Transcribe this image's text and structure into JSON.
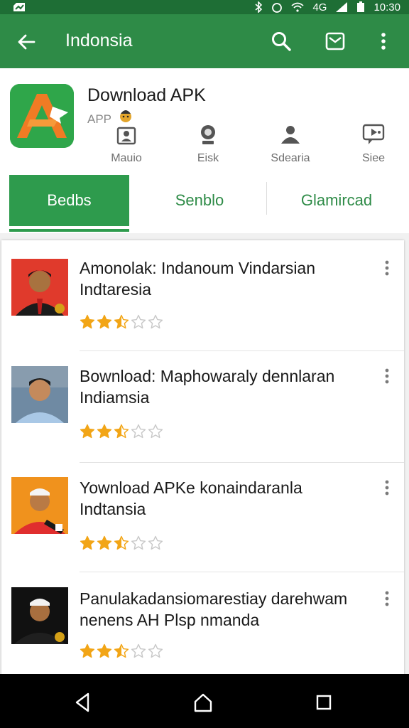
{
  "status_bar": {
    "network": "4G",
    "time": "10:30"
  },
  "app_bar": {
    "title": "Indonsia",
    "back_icon": "arrow-back-icon",
    "actions": [
      "search-icon",
      "mail-icon",
      "more-vert-icon"
    ]
  },
  "header": {
    "app_name": "Download APK",
    "app_sub": "APP",
    "mini_actions": [
      {
        "label": "Mauio",
        "icon": "user-badge-icon"
      },
      {
        "label": "Eisk",
        "icon": "webcam-icon"
      },
      {
        "label": "Sdearia",
        "icon": "person-info-icon"
      },
      {
        "label": "Siee",
        "icon": "chat-video-icon"
      }
    ],
    "tabs": [
      {
        "label": "Bedbs",
        "active": true
      },
      {
        "label": "Senblo",
        "active": false
      },
      {
        "label": "Glamircad",
        "active": false
      }
    ]
  },
  "list": {
    "items": [
      {
        "line1": "Amonolak: Indanoum Vindarsian",
        "line2": "Indtaresia",
        "rating": 2.5,
        "thumb_bg": "#e03a2c"
      },
      {
        "line1": "Bownload: Maphowaraly dennlaran",
        "line2": "Indiamsia",
        "rating": 2.5,
        "thumb_bg": "#5f7f9b"
      },
      {
        "line1": "Yownload APKe konaindaranla",
        "line2": "Indtansia",
        "rating": 2.5,
        "thumb_bg": "#f0921d"
      },
      {
        "line1": "Panulakadansiomarestiay darehwam",
        "line2": "nenens AH Pl​sp nmanda",
        "rating": 2.5,
        "thumb_bg": "#111111"
      }
    ]
  },
  "nav_bar": {
    "buttons": [
      "back-triangle-icon",
      "home-icon",
      "recents-icon"
    ]
  },
  "colors": {
    "primary": "#2e8b47",
    "primary_dark": "#1e6e35",
    "tab_active": "#2e9b4d",
    "star_filled": "#f2a516",
    "star_empty": "#c8c8c8"
  }
}
